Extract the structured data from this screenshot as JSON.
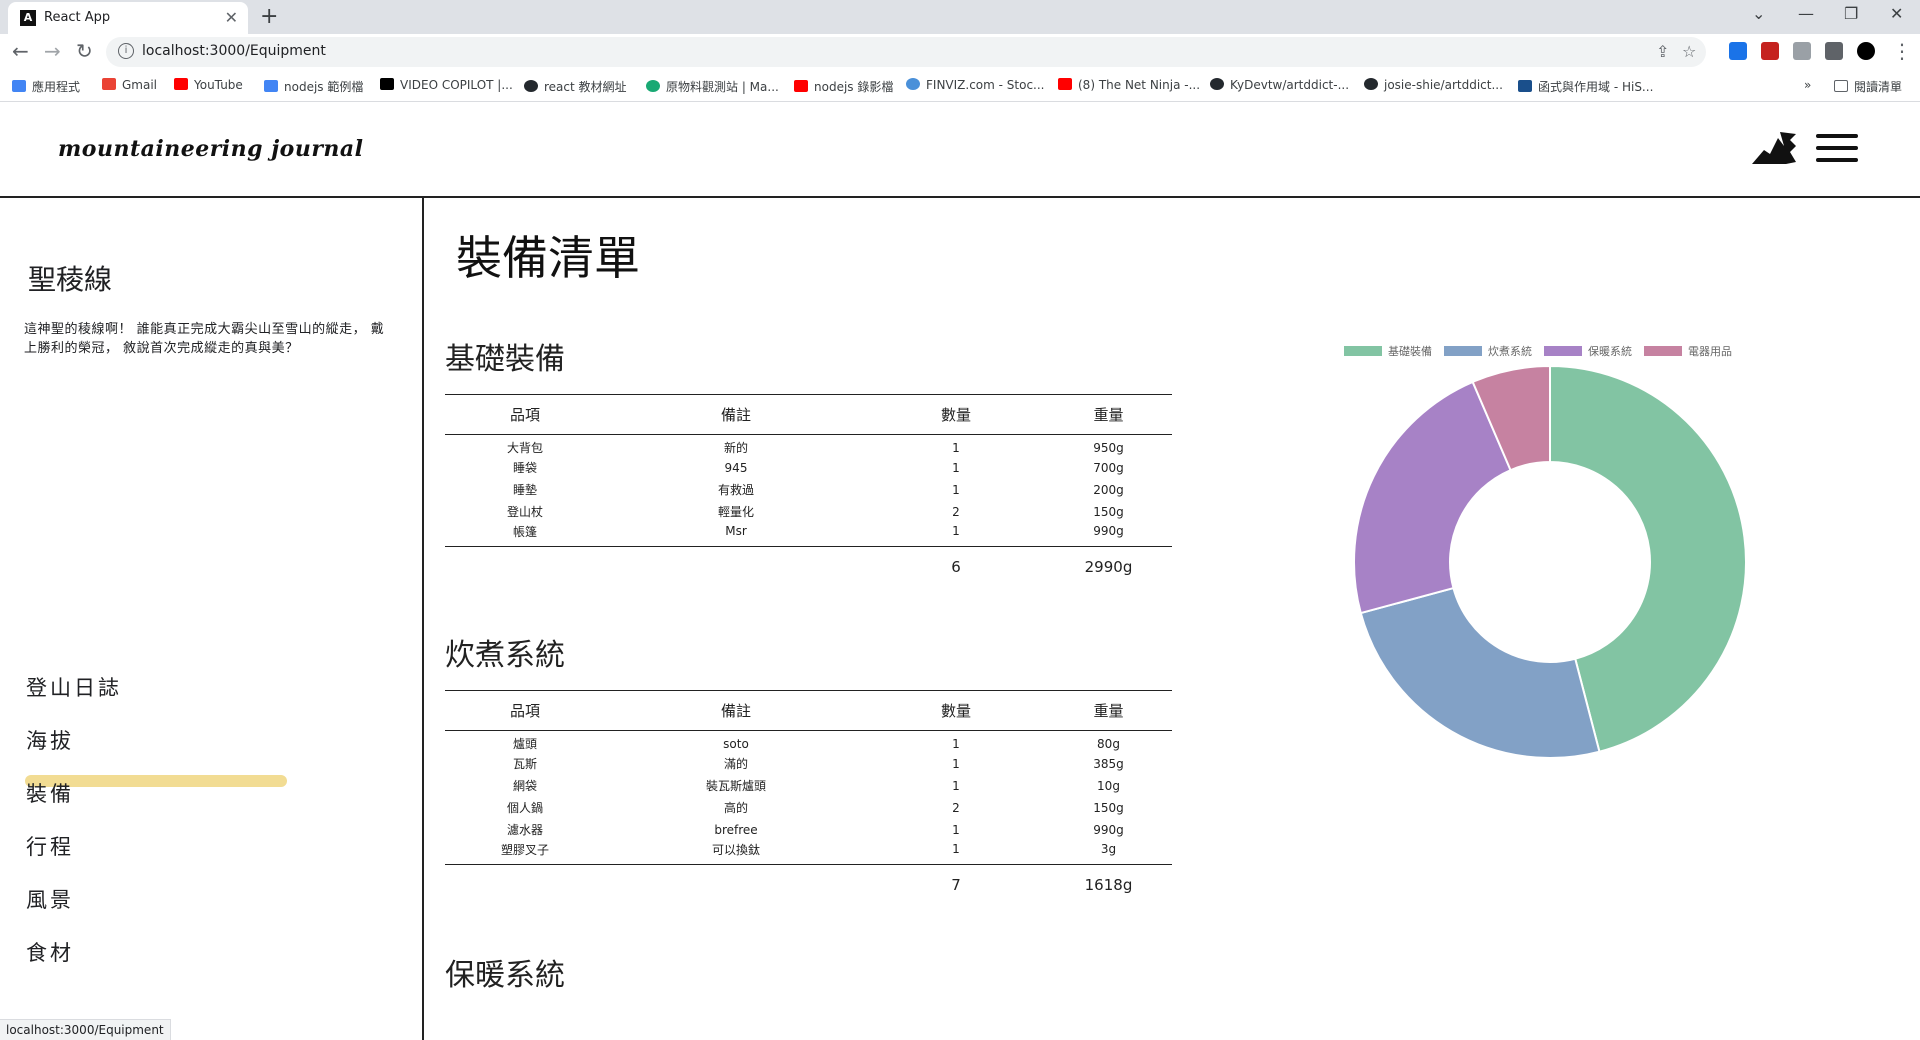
{
  "browser": {
    "tab_title": "React App",
    "url": "localhost:3000/Equipment",
    "bookmarks": [
      "應用程式",
      "Gmail",
      "YouTube",
      "nodejs 範例檔",
      "VIDEO COPILOT |...",
      "react 教材網址",
      "原物料觀測站 | Ma...",
      "nodejs 錄影檔",
      "FINVIZ.com - Stoc...",
      "(8) The Net Ninja -...",
      "KyDevtw/artddict-...",
      "josie-shie/artddict...",
      "函式與作用域 - HiS..."
    ],
    "reading_list": "閱讀清單",
    "status_url": "localhost:3000/Equipment"
  },
  "header": {
    "logo": "mountaineering journal"
  },
  "sidebar": {
    "title": "聖稜線",
    "description": "這神聖的稜線啊！ 誰能真正完成大霸尖山至雪山的縱走， 戴上勝利的榮冠， 敘說首次完成縱走的真與美？",
    "nav": [
      "登山日誌",
      "海拔",
      "裝備",
      "行程",
      "風景",
      "食材"
    ],
    "active_index": 2
  },
  "main": {
    "title": "裝備清單",
    "headers": [
      "品項",
      "備註",
      "數量",
      "重量"
    ],
    "sections": [
      {
        "title": "基礎裝備",
        "rows": [
          [
            "大背包",
            "新的",
            "1",
            "950g"
          ],
          [
            "睡袋",
            "945",
            "1",
            "700g"
          ],
          [
            "睡墊",
            "有救過",
            "1",
            "200g"
          ],
          [
            "登山杖",
            "輕量化",
            "2",
            "150g"
          ],
          [
            "帳篷",
            "Msr",
            "1",
            "990g"
          ]
        ],
        "total_qty": "6",
        "total_weight": "2990g"
      },
      {
        "title": "炊煮系統",
        "rows": [
          [
            "爐頭",
            "soto",
            "1",
            "80g"
          ],
          [
            "瓦斯",
            "滿的",
            "1",
            "385g"
          ],
          [
            "網袋",
            "裝瓦斯爐頭",
            "1",
            "10g"
          ],
          [
            "個人鍋",
            "高的",
            "2",
            "150g"
          ],
          [
            "濾水器",
            "brefree",
            "1",
            "990g"
          ],
          [
            "塑膠叉子",
            "可以換鈦",
            "1",
            "3g"
          ]
        ],
        "total_qty": "7",
        "total_weight": "1618g"
      },
      {
        "title": "保暖系統"
      }
    ]
  },
  "chart_data": {
    "type": "pie",
    "donut": true,
    "categories": [
      "基礎裝備",
      "炊煮系統",
      "保暖系統",
      "電器用品"
    ],
    "values": [
      2990,
      1618,
      1480,
      420
    ],
    "colors": [
      "#82c4a3",
      "#82a1c6",
      "#a782c6",
      "#c682a1"
    ],
    "legend": "top"
  }
}
